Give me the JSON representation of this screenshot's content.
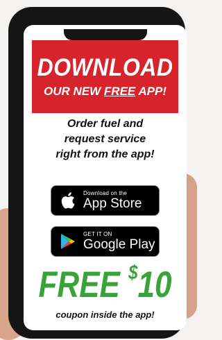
{
  "banner": {
    "title": "DOWNLOAD",
    "subtitle_pre": "OUR NEW ",
    "subtitle_free": "FREE",
    "subtitle_post": " APP!"
  },
  "order": {
    "line1": "Order fuel and",
    "line2": "request service",
    "line3": "right from the app!"
  },
  "app_store": {
    "small": "Download on the",
    "big": "App Store",
    "icon": "apple-icon"
  },
  "google_play": {
    "small": "GET IT ON",
    "big": "Google Play",
    "icon": "google-play-icon"
  },
  "promo": {
    "free": "FREE",
    "dollar": "$",
    "amount": "10",
    "coupon": "coupon inside the app!"
  },
  "colors": {
    "banner_red": "#d7232c",
    "promo_green": "#39a33a",
    "phone_body": "#151515"
  }
}
